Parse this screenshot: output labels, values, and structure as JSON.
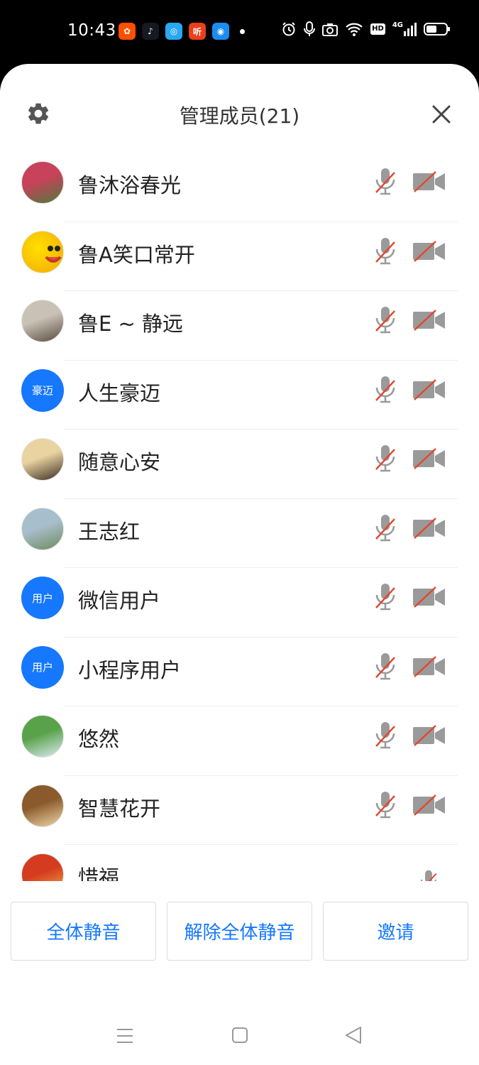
{
  "status_bar": {
    "time": "10:43",
    "apps": [
      {
        "icon": "kuaishou-icon",
        "color": "#ff5000",
        "glyph": "✿"
      },
      {
        "icon": "douyin-icon",
        "color": "#161823",
        "glyph": "♪"
      },
      {
        "icon": "app-bubble-icon",
        "color": "#2aa8f2",
        "glyph": "◎"
      },
      {
        "icon": "ting-icon",
        "color": "#e8401c",
        "glyph": "听"
      },
      {
        "icon": "app-circle-icon",
        "color": "#1b8cf0",
        "glyph": "◉"
      }
    ],
    "hd": "HD",
    "network": "4G"
  },
  "header": {
    "title": "管理成员(21)"
  },
  "members": [
    {
      "name": "鲁沐浴春光",
      "avatar": "photo",
      "colors": [
        "#c7425a",
        "#4e7a3a"
      ]
    },
    {
      "name": "鲁A笑口常开",
      "avatar": "smiley",
      "colors": [
        "#ffe000",
        "#f2a800"
      ]
    },
    {
      "name": "鲁E ~ 静远",
      "avatar": "photo",
      "colors": [
        "#c9c1b6",
        "#5a4a3e"
      ]
    },
    {
      "name": "人生豪迈",
      "avatar": "text",
      "text": "豪迈"
    },
    {
      "name": "随意心安",
      "avatar": "photo",
      "colors": [
        "#e9d3a0",
        "#3a2c22"
      ]
    },
    {
      "name": "王志红",
      "avatar": "photo",
      "colors": [
        "#a7bfcc",
        "#6f8a5f"
      ]
    },
    {
      "name": "微信用户",
      "avatar": "text",
      "text": "用户"
    },
    {
      "name": "小程序用户",
      "avatar": "text",
      "text": "用户"
    },
    {
      "name": "悠然",
      "avatar": "photo",
      "colors": [
        "#5aa24a",
        "#dcebf2"
      ]
    },
    {
      "name": "智慧花开",
      "avatar": "photo",
      "colors": [
        "#8a5a2c",
        "#f0d7a8"
      ]
    },
    {
      "name": "惜福",
      "avatar": "photo",
      "colors": [
        "#d43b1f",
        "#f4b045"
      ]
    }
  ],
  "footer": {
    "mute_all": "全体静音",
    "unmute_all": "解除全体静音",
    "invite": "邀请"
  },
  "colors": {
    "accent": "#1677ff",
    "muted_red": "#e0482f",
    "icon_gray": "#9a9a9a"
  }
}
